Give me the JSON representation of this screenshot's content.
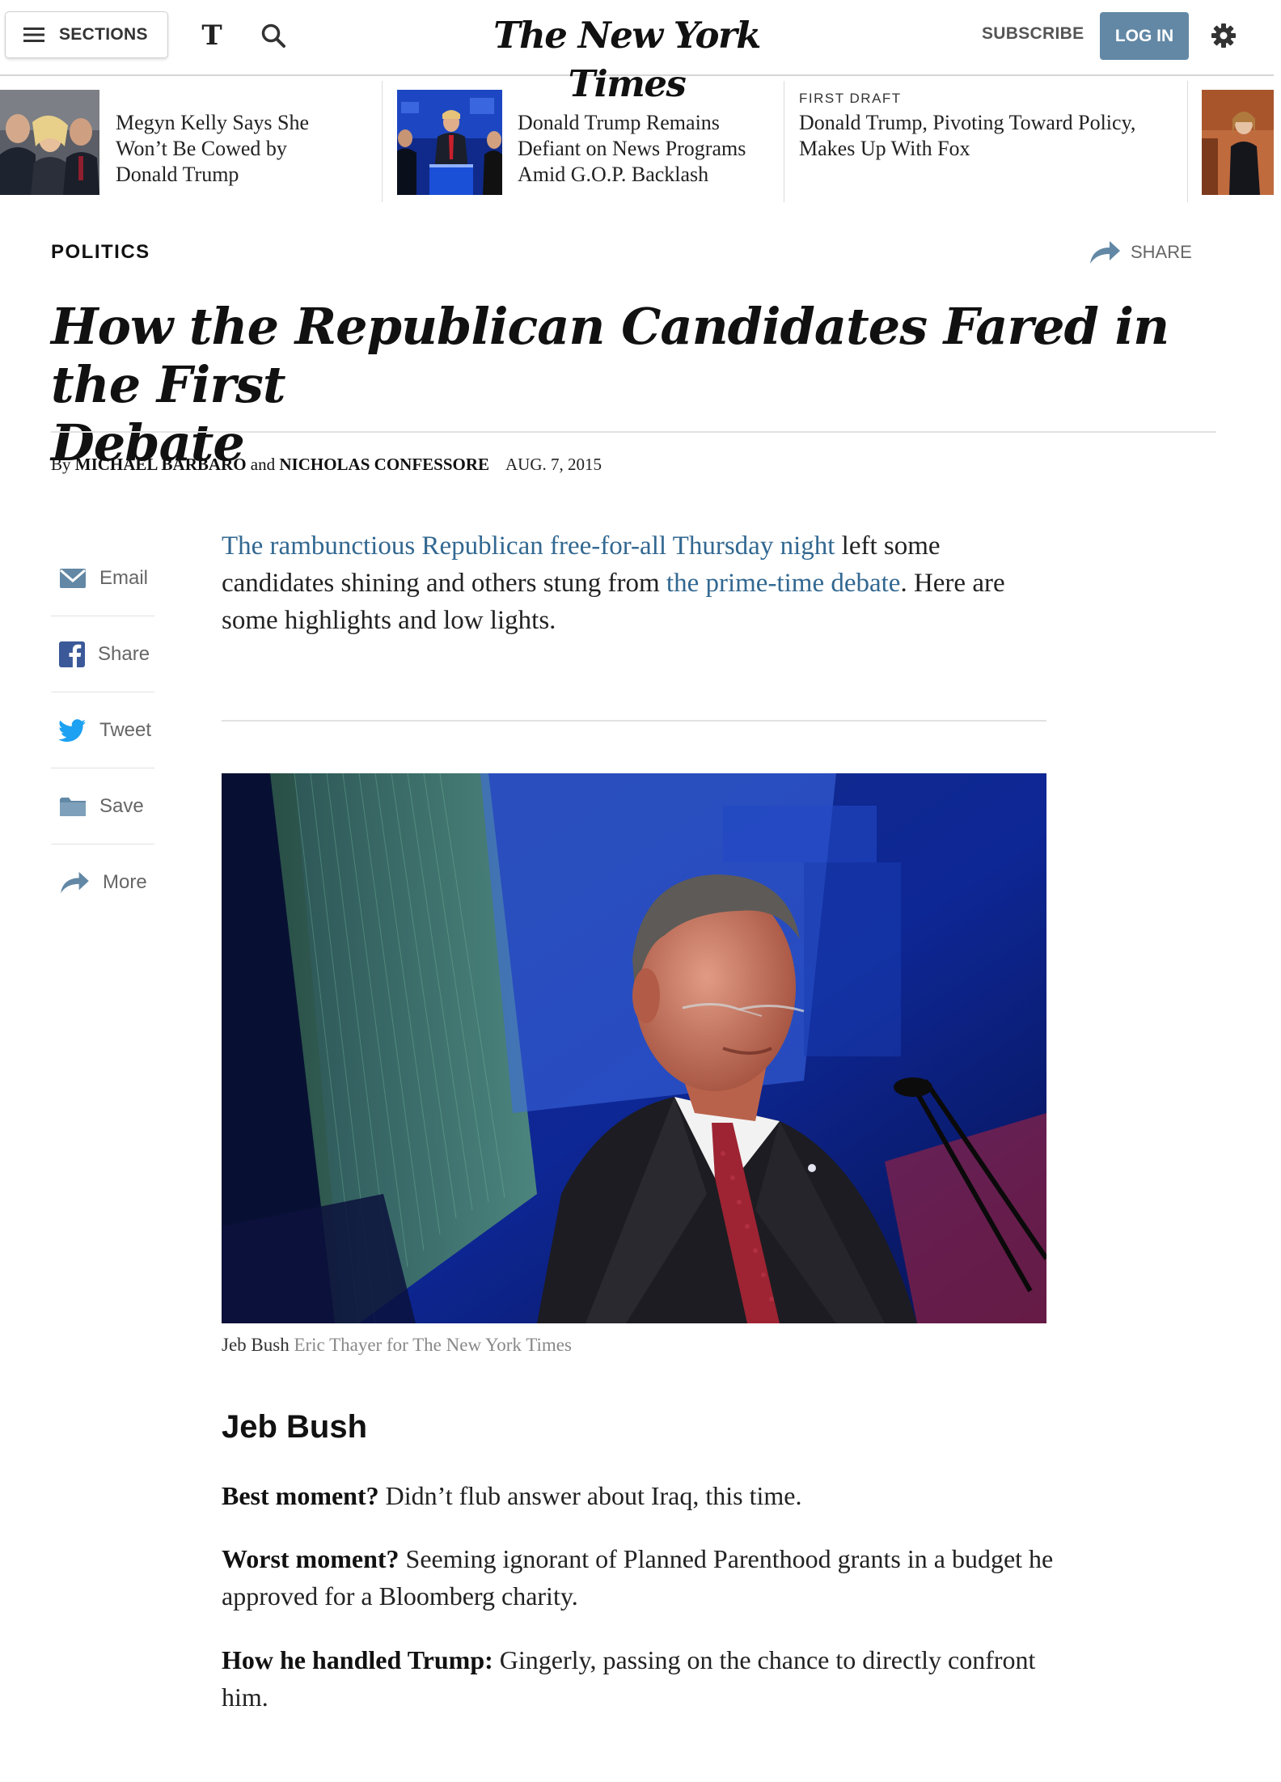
{
  "masthead": {
    "sections_label": "SECTIONS",
    "t_logo": "T",
    "brand": "The New York Times",
    "subscribe_label": "SUBSCRIBE",
    "login_label": "LOG IN"
  },
  "ribbon": {
    "items": [
      {
        "kicker": "",
        "headline_lines": [
          "Megyn Kelly Says She",
          "Won’t Be Cowed by",
          "Donald Trump"
        ]
      },
      {
        "kicker": "",
        "headline_lines": [
          "Donald Trump Remains",
          "Defiant on News Programs",
          "Amid G.O.P. Backlash"
        ]
      },
      {
        "kicker": "FIRST DRAFT",
        "headline_lines": [
          "Donald Trump, Pivoting Toward Policy,",
          "Makes Up With Fox"
        ]
      }
    ]
  },
  "article": {
    "section": "POLITICS",
    "share_label": "SHARE",
    "headline_lines": [
      "How the Republican Candidates Fared in the First",
      "Debate"
    ],
    "byline": {
      "by": "By",
      "author1": "MICHAEL BARBARO",
      "and": "and",
      "author2": "NICHOLAS CONFESSORE",
      "date": "AUG. 7, 2015"
    },
    "lede": {
      "link1": "The rambunctious Republican free-for-all Thursday night",
      "text1": " left some candidates shining and others stung from ",
      "link2": "the prime-time debate",
      "text2": ". Here are some highlights and low lights."
    },
    "photo": {
      "caption": "Jeb Bush",
      "credit": "Eric Thayer for The New York Times"
    },
    "candidate": "Jeb Bush",
    "qa": [
      {
        "label": "Best moment?",
        "text": " Didn’t flub answer about Iraq, this time."
      },
      {
        "label": "Worst moment?",
        "text": " Seeming ignorant of Planned Parenthood grants in a budget he approved for a Bloomberg charity."
      },
      {
        "label": "How he handled Trump:",
        "text": " Gingerly, passing on the chance to directly confront him."
      }
    ]
  },
  "share_rail": {
    "email": "Email",
    "share": "Share",
    "tweet": "Tweet",
    "save": "Save",
    "more": "More"
  },
  "colors": {
    "link": "#326891",
    "login_button": "#6288a5",
    "facebook": "#3b5998",
    "twitter": "#1da1f2",
    "icon_blue": "#6288a5"
  }
}
